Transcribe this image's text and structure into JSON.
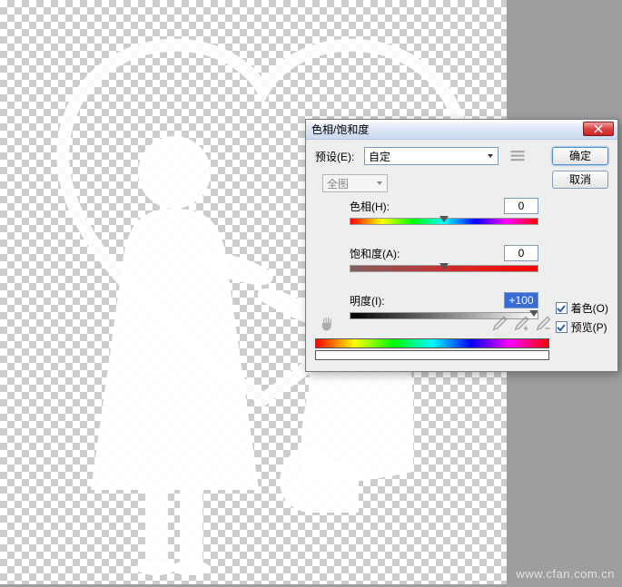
{
  "dialog": {
    "title": "色相/饱和度",
    "preset_label": "预设(E):",
    "preset_value": "自定",
    "ok_label": "确定",
    "cancel_label": "取消",
    "edit_dropdown": "全图",
    "sliders": {
      "hue": {
        "label": "色相(H):",
        "value": "0"
      },
      "saturation": {
        "label": "饱和度(A):",
        "value": "0"
      },
      "lightness": {
        "label": "明度(I):",
        "value": "+100"
      }
    },
    "checks": {
      "colorize_label": "着色(O)",
      "preview_label": "预览(P)"
    }
  },
  "watermark": "www.cfan.com.cn"
}
